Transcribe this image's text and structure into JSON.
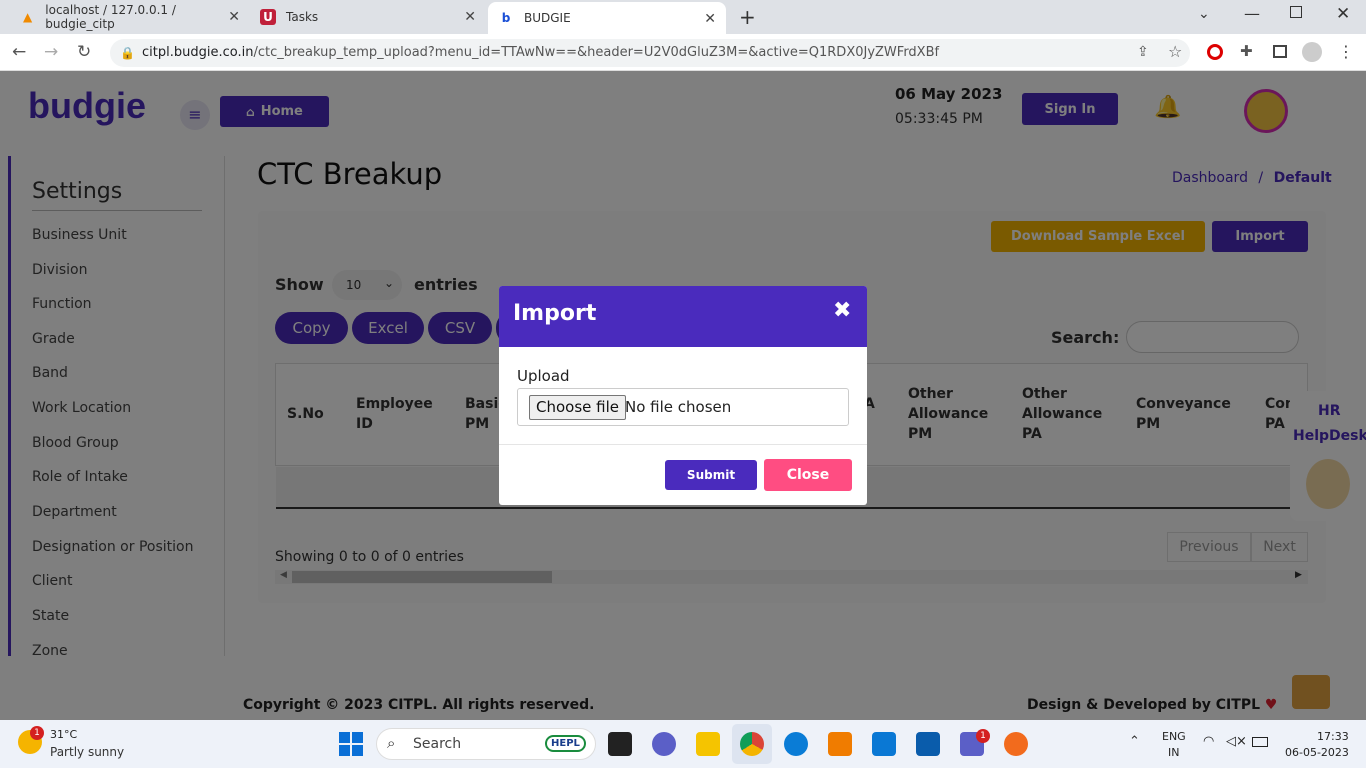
{
  "browser": {
    "tabs": [
      {
        "title": "localhost / 127.0.0.1 / budgie_citp"
      },
      {
        "title": "Tasks"
      },
      {
        "title": "BUDGIE"
      }
    ],
    "url_domain": "citpl.budgie.co.in",
    "url_path": "/ctc_breakup_temp_upload?menu_id=TTAwNw==&header=U2V0dGluZ3M=&active=Q1RDX0JyZWFrdXBf"
  },
  "header": {
    "logo": "budgie",
    "home_label": "Home",
    "date": "06 May 2023",
    "time": "05:33:45 PM",
    "signin_label": "Sign In"
  },
  "sidebar": {
    "title": "Settings",
    "items": [
      "Business Unit",
      "Division",
      "Function",
      "Grade",
      "Band",
      "Work Location",
      "Blood Group",
      "Role of Intake",
      "Department",
      "Designation or Position",
      "Client",
      "State",
      "Zone"
    ]
  },
  "main": {
    "title": "CTC Breakup",
    "breadcrumb": {
      "dashboard": "Dashboard",
      "sep": "/",
      "current": "Default"
    },
    "download_label": "Download Sample Excel",
    "import_label": "Import",
    "show_label": "Show",
    "entries_value": "10",
    "entries_label": "entries",
    "buttons": {
      "copy": "Copy",
      "excel": "Excel",
      "csv": "CSV"
    },
    "search_label": "Search:",
    "columns": [
      "S.No",
      "Employee ID",
      "Basic PM",
      "",
      "Other Allowance PM",
      "Other Allowance PA",
      "Conveyance PM",
      "Con PA"
    ],
    "col_fragment": "A",
    "info": "Showing 0 to 0 of 0 entries",
    "prev_label": "Previous",
    "next_label": "Next"
  },
  "helpdesk": {
    "line1": "HR",
    "line2": "HelpDesk"
  },
  "footer": {
    "copyright": "Copyright © 2023 CITPL. All rights reserved.",
    "credit": "Design & Developed by CITPL"
  },
  "modal": {
    "title": "Import",
    "upload_label": "Upload",
    "choose_file": "Choose file",
    "no_file": "No file chosen",
    "submit": "Submit",
    "close": "Close"
  },
  "taskbar": {
    "weather_temp": "31°C",
    "weather_desc": "Partly sunny",
    "weather_badge": "1",
    "search_placeholder": "Search",
    "search_badge": "HEPL",
    "lang1": "ENG",
    "lang2": "IN",
    "time": "17:33",
    "date": "06-05-2023",
    "teams_badge": "1"
  },
  "colors": {
    "primary": "#4a2bbd",
    "accent": "#f5b400",
    "close": "#ff4d82"
  }
}
